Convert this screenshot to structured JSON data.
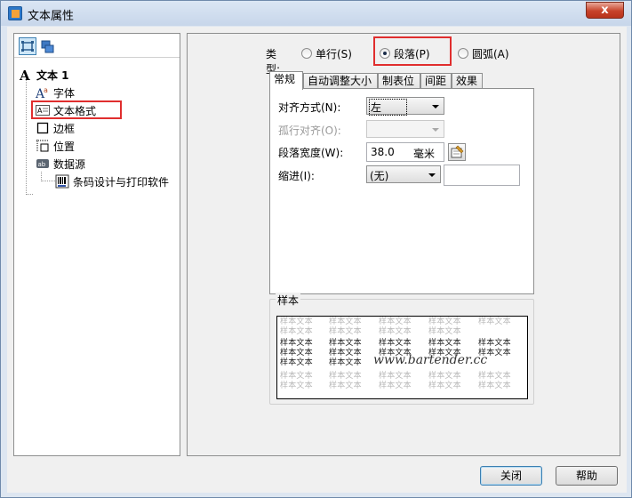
{
  "window": {
    "title": "文本属性",
    "close_glyph": "x"
  },
  "tree": {
    "items": [
      {
        "label": "文本 1",
        "icon": "text-object-icon"
      },
      {
        "label": "字体",
        "icon": "font-icon"
      },
      {
        "label": "文本格式",
        "icon": "text-format-icon",
        "selected": true
      },
      {
        "label": "边框",
        "icon": "border-icon"
      },
      {
        "label": "位置",
        "icon": "position-icon"
      },
      {
        "label": "数据源",
        "icon": "datasource-icon"
      },
      {
        "label": "条码设计与打印软件",
        "icon": "barcode-icon"
      }
    ]
  },
  "type_selector": {
    "label": "类型:",
    "options": [
      {
        "label": "单行(S)",
        "checked": false
      },
      {
        "label": "段落(P)",
        "checked": true
      },
      {
        "label": "圆弧(A)",
        "checked": false
      }
    ]
  },
  "tabs": [
    "常规",
    "自动调整大小",
    "制表位",
    "间距",
    "效果"
  ],
  "general": {
    "align_label": "对齐方式(N):",
    "align_value": "左",
    "orphan_label": "孤行对齐(O):",
    "orphan_value": "",
    "width_label": "段落宽度(W):",
    "width_value": "38.0",
    "width_unit": "毫米",
    "indent_label": "缩进(I):",
    "indent_value": "(无)",
    "indent_text": ""
  },
  "sample": {
    "title": "样本",
    "word": "样本文本",
    "watermark": "www.bartender.cc"
  },
  "buttons": {
    "close": "关闭",
    "help": "帮助"
  }
}
